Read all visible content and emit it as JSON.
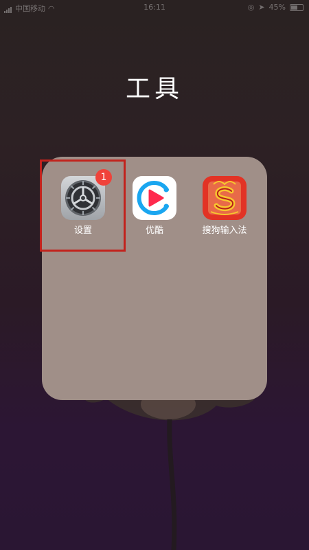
{
  "status_bar": {
    "carrier": "中国移动",
    "time": "16:11",
    "battery": "45%"
  },
  "folder": {
    "title": "工具",
    "apps": [
      {
        "label": "设置",
        "icon": "settings-gear-icon",
        "badge": "1"
      },
      {
        "label": "优酷",
        "icon": "youku-play-icon"
      },
      {
        "label": "搜狗输入法",
        "icon": "sogou-input-icon"
      }
    ]
  },
  "colors": {
    "folder_bg": "#a08f88",
    "badge": "#f0423a",
    "highlight": "#c2231d",
    "youku_blue": "#1aa6f0",
    "youku_red": "#ff2a4e",
    "sogou_red": "#e23325",
    "sogou_yellow": "#f7c62f"
  }
}
